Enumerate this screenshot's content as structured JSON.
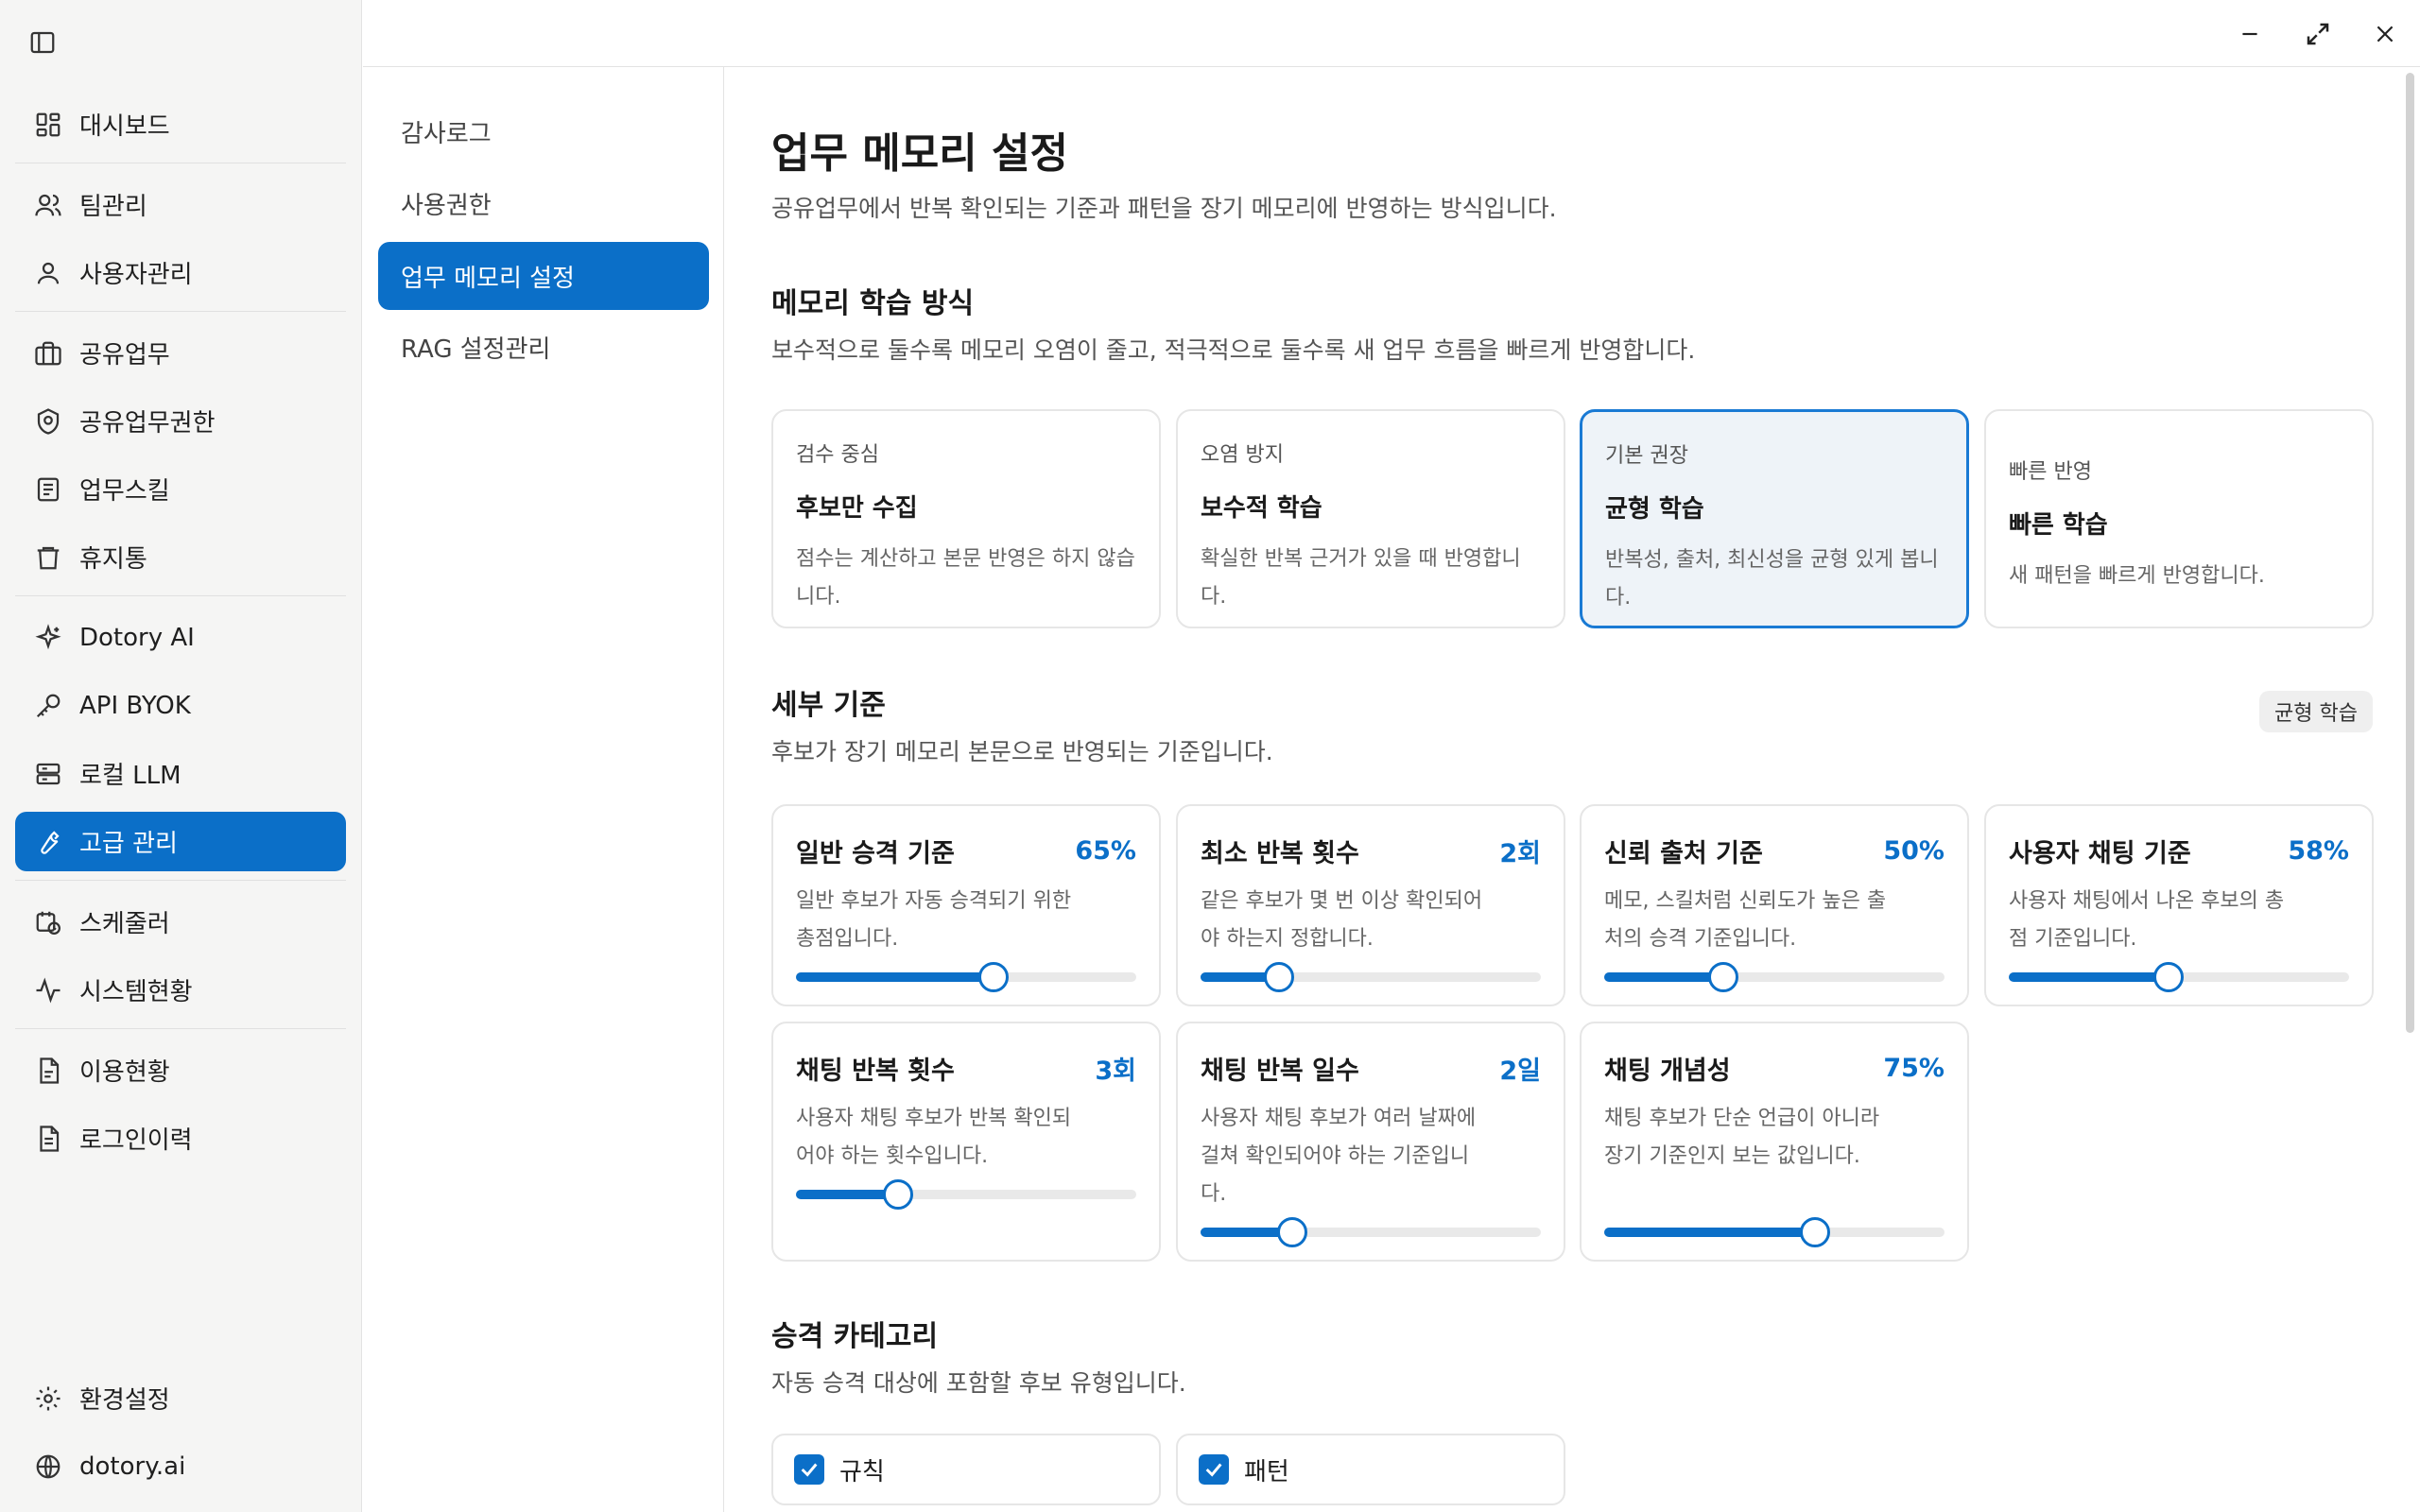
{
  "sidebar": {
    "items": [
      {
        "label": "대시보드",
        "icon": "dashboard-icon"
      },
      {
        "label": "팀관리",
        "icon": "team-icon"
      },
      {
        "label": "사용자관리",
        "icon": "user-icon"
      },
      {
        "label": "공유업무",
        "icon": "briefcase-icon"
      },
      {
        "label": "공유업무권한",
        "icon": "shield-icon"
      },
      {
        "label": "업무스킬",
        "icon": "document-icon"
      },
      {
        "label": "휴지통",
        "icon": "trash-icon"
      },
      {
        "label": "Dotory AI",
        "icon": "sparkle-icon"
      },
      {
        "label": "API BYOK",
        "icon": "key-icon"
      },
      {
        "label": "로컬 LLM",
        "icon": "server-icon"
      },
      {
        "label": "고급 관리",
        "icon": "wrench-icon"
      },
      {
        "label": "스케줄러",
        "icon": "calendar-clock-icon"
      },
      {
        "label": "시스템현황",
        "icon": "activity-icon"
      },
      {
        "label": "이용현황",
        "icon": "file-chart-icon"
      },
      {
        "label": "로그인이력",
        "icon": "file-list-icon"
      }
    ],
    "bottom": [
      {
        "label": "환경설정",
        "icon": "gear-icon"
      },
      {
        "label": "dotory.ai",
        "icon": "globe-icon"
      }
    ]
  },
  "submenu": {
    "items": [
      "감사로그",
      "사용권한",
      "업무 메모리 설정",
      "RAG 설정관리"
    ]
  },
  "page": {
    "title": "업무 메모리 설정",
    "subtitle": "공유업무에서 반복 확인되는 기준과 패턴을 장기 메모리에 반영하는 방식입니다."
  },
  "learning": {
    "title": "메모리 학습 방식",
    "subtitle": "보수적으로 둘수록 메모리 오염이 줄고, 적극적으로 둘수록 새 업무 흐름을 빠르게 반영합니다.",
    "modes": [
      {
        "eyebrow": "검수 중심",
        "title": "후보만 수집",
        "desc": "점수는 계산하고 본문 반영은 하지 않습니다."
      },
      {
        "eyebrow": "오염 방지",
        "title": "보수적 학습",
        "desc": "확실한 반복 근거가 있을 때 반영합니다."
      },
      {
        "eyebrow": "기본 권장",
        "title": "균형 학습",
        "desc": "반복성, 출처, 최신성을 균형 있게 봅니다."
      },
      {
        "eyebrow": "빠른 반영",
        "title": "빠른 학습",
        "desc": "새 패턴을 빠르게 반영합니다."
      }
    ]
  },
  "criteria": {
    "title": "세부 기준",
    "subtitle": "후보가 장기 메모리 본문으로 반영되는 기준입니다.",
    "badge": "균형 학습",
    "items": [
      {
        "title": "일반 승격 기준",
        "value": "65%",
        "desc": "일반 후보가 자동 승격되기 위한 총점입니다.",
        "level": 0.58
      },
      {
        "title": "최소 반복 횟수",
        "value": "2회",
        "desc": "같은 후보가 몇 번 이상 확인되어야 하는지 정합니다.",
        "level": 0.23
      },
      {
        "title": "신뢰 출처 기준",
        "value": "50%",
        "desc": "메모, 스킬처럼 신뢰도가 높은 출처의 승격 기준입니다.",
        "level": 0.35
      },
      {
        "title": "사용자 채팅 기준",
        "value": "58%",
        "desc": "사용자 채팅에서 나온 후보의 총점 기준입니다.",
        "level": 0.47
      },
      {
        "title": "채팅 반복 횟수",
        "value": "3회",
        "desc": "사용자 채팅 후보가 반복 확인되어야 하는 횟수입니다.",
        "level": 0.3
      },
      {
        "title": "채팅 반복 일수",
        "value": "2일",
        "desc": "사용자 채팅 후보가 여러 날짜에 걸쳐 확인되어야 하는 기준입니다.",
        "level": 0.27
      },
      {
        "title": "채팅 개념성",
        "value": "75%",
        "desc": "채팅 후보가 단순 언급이 아니라 장기 기준인지 보는 값입니다.",
        "level": 0.62
      }
    ]
  },
  "categories": {
    "title": "승격 카테고리",
    "subtitle": "자동 승격 대상에 포함할 후보 유형입니다.",
    "items": [
      {
        "label": "규칙",
        "checked": true
      },
      {
        "label": "패턴",
        "checked": true
      }
    ]
  },
  "colors": {
    "accent": "#0b6fc8",
    "selected_bg": "#eef3f8"
  }
}
